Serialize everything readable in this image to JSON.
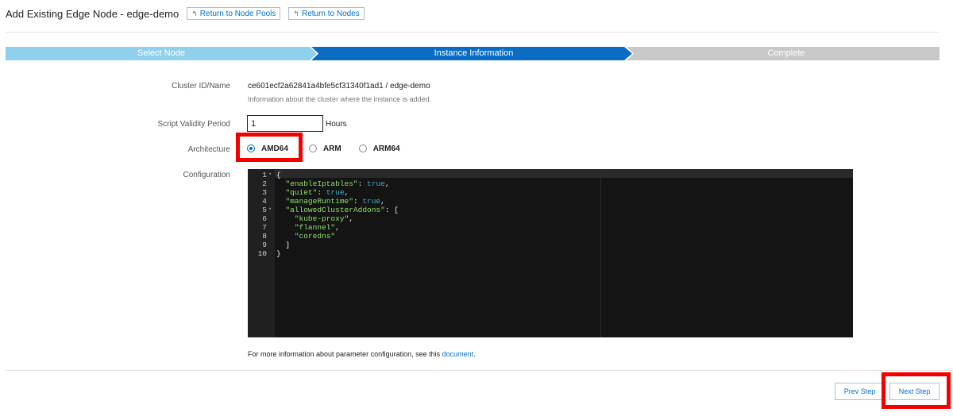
{
  "header": {
    "title": "Add Existing Edge Node - edge-demo",
    "return_node_pools": "Return to Node Pools",
    "return_nodes": "Return to Nodes",
    "return_icon": "↰"
  },
  "steps": [
    {
      "label": "Select Node",
      "state": "done",
      "color": "#8fd0ec"
    },
    {
      "label": "Instance Information",
      "state": "active",
      "color": "#0a6cc4"
    },
    {
      "label": "Complete",
      "state": "pending",
      "color": "#c8c8c8"
    }
  ],
  "form": {
    "cluster_label": "Cluster ID/Name",
    "cluster_value": "ce601ecf2a62841a4bfe5cf31340f1ad1 / edge-demo",
    "cluster_hint": "Information about the cluster where the instance is added.",
    "validity_label": "Script Validity Period",
    "validity_value": "1",
    "validity_unit": "Hours",
    "arch_label": "Architecture",
    "arch_options": [
      {
        "label": "AMD64",
        "checked": true
      },
      {
        "label": "ARM",
        "checked": false
      },
      {
        "label": "ARM64",
        "checked": false
      }
    ],
    "config_label": "Configuration"
  },
  "editor": {
    "lines": [
      {
        "n": "1",
        "fold": true,
        "text": "{"
      },
      {
        "n": "2",
        "fold": false,
        "key": "\"enableIptables\"",
        "val": "true",
        "vtype": "bool",
        "tail": ","
      },
      {
        "n": "3",
        "fold": false,
        "key": "\"quiet\"",
        "val": "true",
        "vtype": "bool",
        "tail": ","
      },
      {
        "n": "4",
        "fold": false,
        "key": "\"manageRuntime\"",
        "val": "true",
        "vtype": "bool",
        "tail": ","
      },
      {
        "n": "5",
        "fold": true,
        "key": "\"allowedClusterAddons\"",
        "val": "[",
        "vtype": "punct",
        "tail": ""
      },
      {
        "n": "6",
        "fold": false,
        "str": "\"kube-proxy\"",
        "tail": ",",
        "indent": 2
      },
      {
        "n": "7",
        "fold": false,
        "str": "\"flannel\"",
        "tail": ",",
        "indent": 2
      },
      {
        "n": "8",
        "fold": false,
        "str": "\"coredns\"",
        "tail": "",
        "indent": 2
      },
      {
        "n": "9",
        "fold": false,
        "text": "  ]"
      },
      {
        "n": "10",
        "fold": false,
        "text": "}"
      }
    ]
  },
  "more_info": {
    "prefix": "For more information about parameter configuration, see this ",
    "link": "document",
    "suffix": "."
  },
  "footer": {
    "prev_label": "Prev Step",
    "next_label": "Next Step"
  },
  "highlight_color": "#f40000"
}
